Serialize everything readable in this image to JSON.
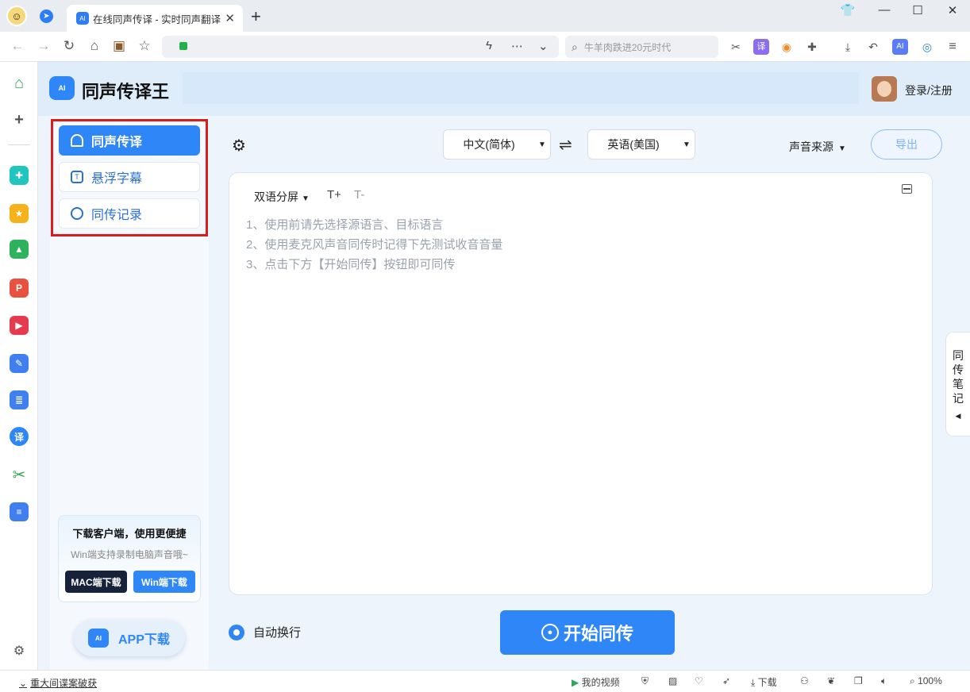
{
  "browser": {
    "tab_title": "在线同声传译 - 实时同声翻译",
    "search_placeholder": "牛羊肉跌进20元时代",
    "zoom": "100%",
    "status_news": "重大间谍案破获",
    "status_video": "我的视频",
    "status_download": "下载"
  },
  "app": {
    "brand": "同声传译王",
    "login": "登录/注册",
    "menu": [
      {
        "label": "同声传译"
      },
      {
        "label": "悬浮字幕"
      },
      {
        "label": "同传记录"
      }
    ],
    "download_card": {
      "title": "下载客户端，使用更便捷",
      "subtitle": "Win端支持录制电脑声音哦~",
      "mac_button": "MAC端下载",
      "win_button": "Win端下载"
    },
    "app_download": "APP下载",
    "source_lang": "中文(简体)",
    "target_lang": "英语(美国)",
    "audio_source": "声音来源",
    "export": "导出",
    "display_mode": "双语分屏",
    "font_plus": "T+",
    "font_minus": "T-",
    "hints": [
      "1、使用前请先选择源语言、目标语言",
      "2、使用麦克风声音同传时记得下先测试收音音量",
      "3、点击下方【开始同传】按钮即可同传"
    ],
    "auto_wrap": "自动换行",
    "start_button": "开始同传",
    "notes_tab": "同传笔记"
  }
}
